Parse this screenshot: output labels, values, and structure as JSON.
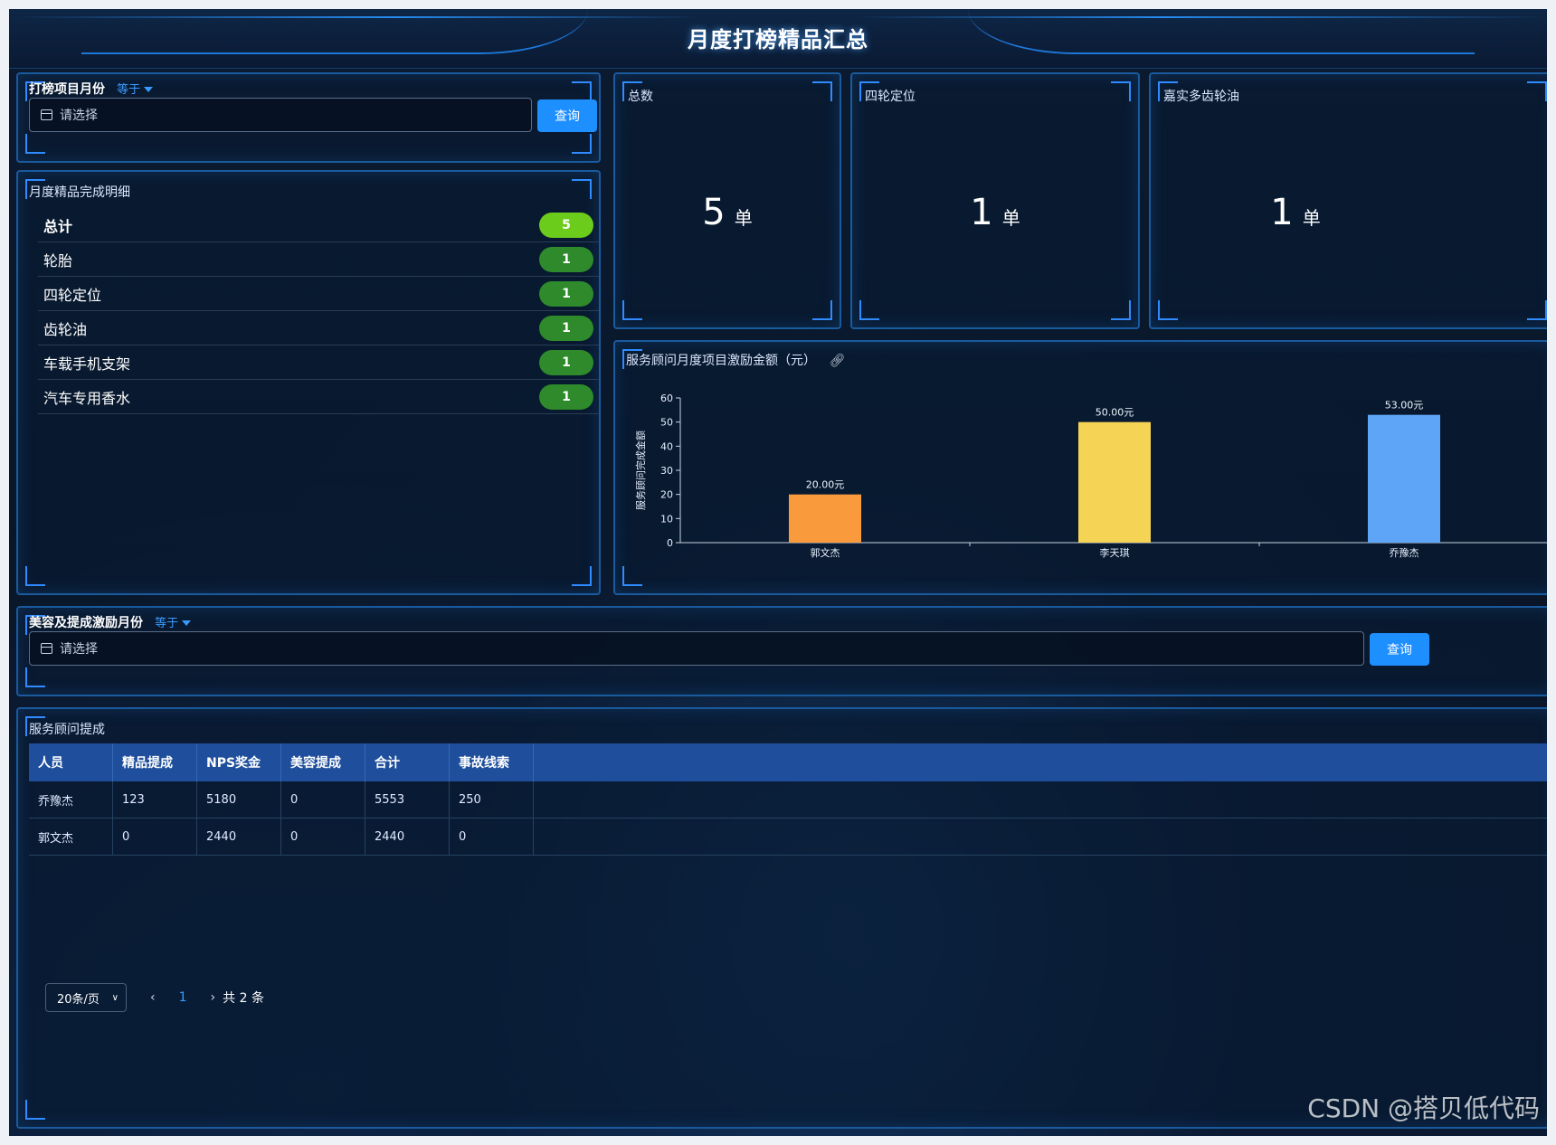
{
  "header": {
    "title": "月度打榜精品汇总"
  },
  "filter1": {
    "label": "打榜项目月份",
    "operator": "等于",
    "placeholder": "请选择",
    "button": "查询"
  },
  "detail": {
    "title": "月度精品完成明细",
    "rows": [
      {
        "name": "总计",
        "count": "5"
      },
      {
        "name": "轮胎",
        "count": "1"
      },
      {
        "name": "四轮定位",
        "count": "1"
      },
      {
        "name": "齿轮油",
        "count": "1"
      },
      {
        "name": "车载手机支架",
        "count": "1"
      },
      {
        "name": "汽车专用香水",
        "count": "1"
      }
    ]
  },
  "stats": [
    {
      "title": "总数",
      "value": "5",
      "unit": "单"
    },
    {
      "title": "四轮定位",
      "value": "1",
      "unit": "单"
    },
    {
      "title": "嘉实多齿轮油",
      "value": "1",
      "unit": "单"
    }
  ],
  "chart": {
    "title": "服务顾问月度项目激励金额（元）"
  },
  "chart_data": {
    "type": "bar",
    "categories": [
      "郭文杰",
      "李天琪",
      "乔豫杰"
    ],
    "values": [
      20,
      50,
      53
    ],
    "value_labels": [
      "20.00元",
      "50.00元",
      "53.00元"
    ],
    "colors": [
      "#f99a3d",
      "#f5d455",
      "#5ea5f8"
    ],
    "ylabel": "服务顾问完成金额",
    "ylim": [
      0,
      60
    ],
    "yticks": [
      0,
      10,
      20,
      30,
      40,
      50,
      60
    ],
    "grid": false
  },
  "filter2": {
    "label": "美容及提成激励月份",
    "operator": "等于",
    "placeholder": "请选择",
    "button": "查询"
  },
  "table": {
    "title": "服务顾问提成",
    "columns": [
      "人员",
      "精品提成",
      "NPS奖金",
      "美容提成",
      "合计",
      "事故线索"
    ],
    "rows": [
      [
        "乔豫杰",
        "123",
        "5180",
        "0",
        "5553",
        "250"
      ],
      [
        "郭文杰",
        "0",
        "2440",
        "0",
        "2440",
        "0"
      ]
    ]
  },
  "pagination": {
    "page_size": "20条/页",
    "current_page": "1",
    "total": "共 2 条"
  },
  "watermark": "CSDN @搭贝低代码"
}
